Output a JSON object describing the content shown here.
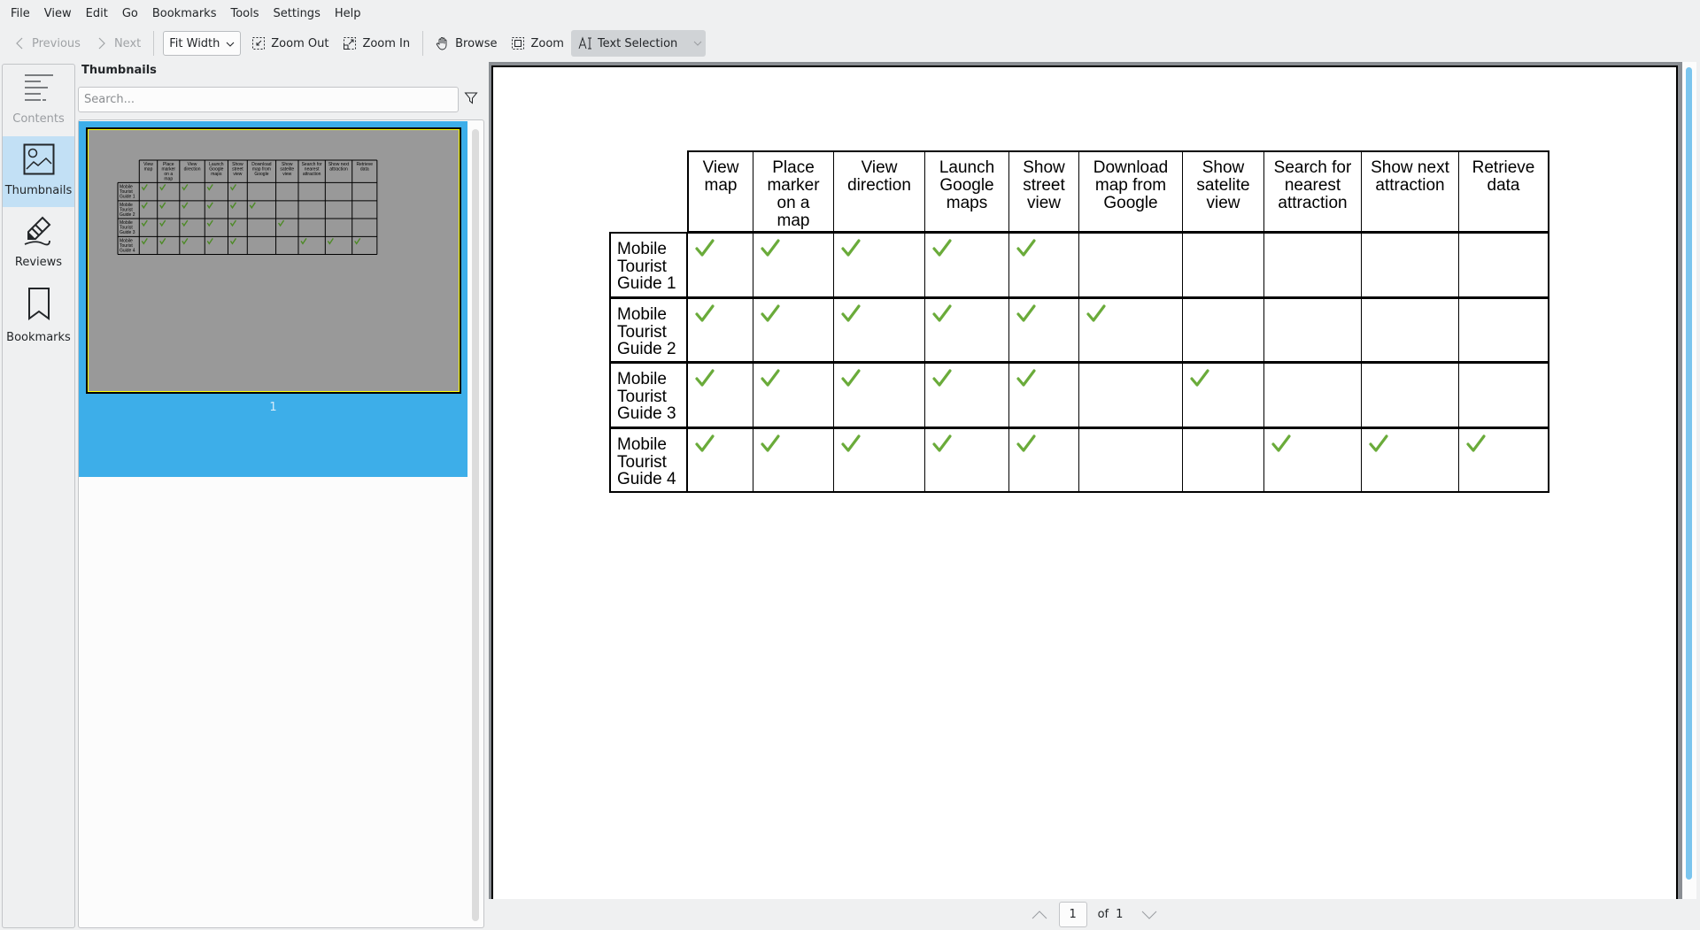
{
  "menubar": {
    "items": [
      "File",
      "View",
      "Edit",
      "Go",
      "Bookmarks",
      "Tools",
      "Settings",
      "Help"
    ]
  },
  "toolbar": {
    "previous_label": "Previous",
    "next_label": "Next",
    "zoom_mode": "Fit Width",
    "zoom_out_label": "Zoom Out",
    "zoom_in_label": "Zoom In",
    "browse_label": "Browse",
    "zoom_label": "Zoom",
    "text_selection_label": "Text Selection"
  },
  "sidebar": {
    "items": [
      {
        "label": "Contents",
        "icon": "contents-icon",
        "state": "disabled"
      },
      {
        "label": "Thumbnails",
        "icon": "thumbnails-icon",
        "state": "selected"
      },
      {
        "label": "Reviews",
        "icon": "reviews-icon",
        "state": "normal"
      },
      {
        "label": "Bookmarks",
        "icon": "bookmarks-icon",
        "state": "normal"
      }
    ]
  },
  "thumbnails_panel": {
    "title": "Thumbnails",
    "search_placeholder": "Search...",
    "pages": [
      {
        "number": "1",
        "selected": true
      }
    ]
  },
  "document": {
    "table": {
      "columns": [
        "View map",
        "Place marker on a map",
        "View direction",
        "Launch Google maps",
        "Show street view",
        "Download map from Google",
        "Show satelite view",
        "Search for nearest attraction",
        "Show next attraction",
        "Retrieve data"
      ],
      "header_lines": [
        [
          "View",
          "map"
        ],
        [
          "Place",
          "marker",
          "on a",
          "map"
        ],
        [
          "View",
          "direction"
        ],
        [
          "Launch",
          "Google",
          "maps"
        ],
        [
          "Show",
          "street",
          "view"
        ],
        [
          "Download",
          "map from",
          "Google"
        ],
        [
          "Show",
          "satelite",
          "view"
        ],
        [
          "Search for",
          "nearest",
          "attraction"
        ],
        [
          "Show next",
          "attraction"
        ],
        [
          "Retrieve",
          "data"
        ]
      ],
      "rows": [
        {
          "label_lines": [
            "Mobile",
            "Tourist",
            "Guide 1"
          ],
          "checks": [
            true,
            true,
            true,
            true,
            true,
            false,
            false,
            false,
            false,
            false
          ]
        },
        {
          "label_lines": [
            "Mobile",
            "Tourist",
            "Guide 2"
          ],
          "checks": [
            true,
            true,
            true,
            true,
            true,
            true,
            false,
            false,
            false,
            false
          ]
        },
        {
          "label_lines": [
            "Mobile",
            "Tourist",
            "Guide 3"
          ],
          "checks": [
            true,
            true,
            true,
            true,
            true,
            false,
            true,
            false,
            false,
            false
          ]
        },
        {
          "label_lines": [
            "Mobile",
            "Tourist",
            "Guide 4"
          ],
          "checks": [
            true,
            true,
            true,
            true,
            true,
            false,
            false,
            true,
            true,
            true
          ]
        }
      ],
      "check_color": "#6aab3a"
    }
  },
  "pagebar": {
    "current_page": "1",
    "of_label": "of",
    "total_pages": "1"
  },
  "colors": {
    "accent": "#3daee9",
    "selected_nav": "#c2e0f5"
  }
}
